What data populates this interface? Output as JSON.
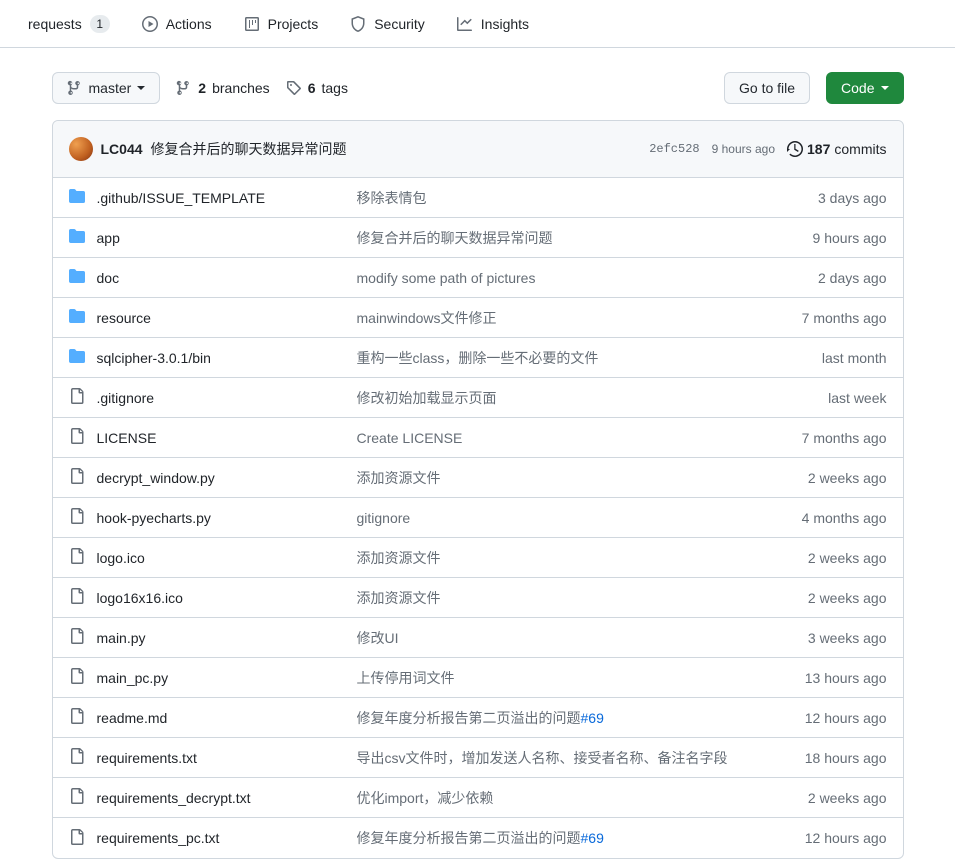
{
  "nav": {
    "items": [
      {
        "label": "requests",
        "count": "1",
        "iconRaw": ""
      },
      {
        "label": "Actions",
        "icon": "play"
      },
      {
        "label": "Projects",
        "icon": "project"
      },
      {
        "label": "Security",
        "icon": "shield"
      },
      {
        "label": "Insights",
        "icon": "graph"
      }
    ]
  },
  "toolbar": {
    "branch_name": "master",
    "branches_count": "2",
    "branches_label": "branches",
    "tags_count": "6",
    "tags_label": "tags",
    "go_to_file": "Go to file",
    "code_label": "Code"
  },
  "latest_commit": {
    "author": "LC044",
    "message": "修复合并后的聊天数据异常问题",
    "hash": "2efc528",
    "time": "9 hours ago",
    "commits_count": "187",
    "commits_label": "commits"
  },
  "files": [
    {
      "type": "dir",
      "name": ".github/ISSUE_TEMPLATE",
      "message": "移除表情包",
      "time": "3 days ago"
    },
    {
      "type": "dir",
      "name": "app",
      "message": "修复合并后的聊天数据异常问题",
      "time": "9 hours ago"
    },
    {
      "type": "dir",
      "name": "doc",
      "message": "modify some path of pictures",
      "time": "2 days ago"
    },
    {
      "type": "dir",
      "name": "resource",
      "message": "mainwindows文件修正",
      "time": "7 months ago"
    },
    {
      "type": "dir",
      "name": "sqlcipher-3.0.1/bin",
      "message": "重构一些class，删除一些不必要的文件",
      "time": "last month"
    },
    {
      "type": "file",
      "name": ".gitignore",
      "message": "修改初始加载显示页面",
      "time": "last week"
    },
    {
      "type": "file",
      "name": "LICENSE",
      "message": "Create LICENSE",
      "time": "7 months ago"
    },
    {
      "type": "file",
      "name": "decrypt_window.py",
      "message": "添加资源文件",
      "time": "2 weeks ago"
    },
    {
      "type": "file",
      "name": "hook-pyecharts.py",
      "message": "gitignore",
      "time": "4 months ago"
    },
    {
      "type": "file",
      "name": "logo.ico",
      "message": "添加资源文件",
      "time": "2 weeks ago"
    },
    {
      "type": "file",
      "name": "logo16x16.ico",
      "message": "添加资源文件",
      "time": "2 weeks ago"
    },
    {
      "type": "file",
      "name": "main.py",
      "message": "修改UI",
      "time": "3 weeks ago"
    },
    {
      "type": "file",
      "name": "main_pc.py",
      "message": "上传停用词文件",
      "time": "13 hours ago"
    },
    {
      "type": "file",
      "name": "readme.md",
      "message": "修复年度分析报告第二页溢出的问题",
      "issue": "#69",
      "time": "12 hours ago"
    },
    {
      "type": "file",
      "name": "requirements.txt",
      "message": "导出csv文件时，增加发送人名称、接受者名称、备注名字段",
      "time": "18 hours ago"
    },
    {
      "type": "file",
      "name": "requirements_decrypt.txt",
      "message": "优化import，减少依赖",
      "time": "2 weeks ago"
    },
    {
      "type": "file",
      "name": "requirements_pc.txt",
      "message": "修复年度分析报告第二页溢出的问题",
      "issue": "#69",
      "time": "12 hours ago"
    }
  ]
}
